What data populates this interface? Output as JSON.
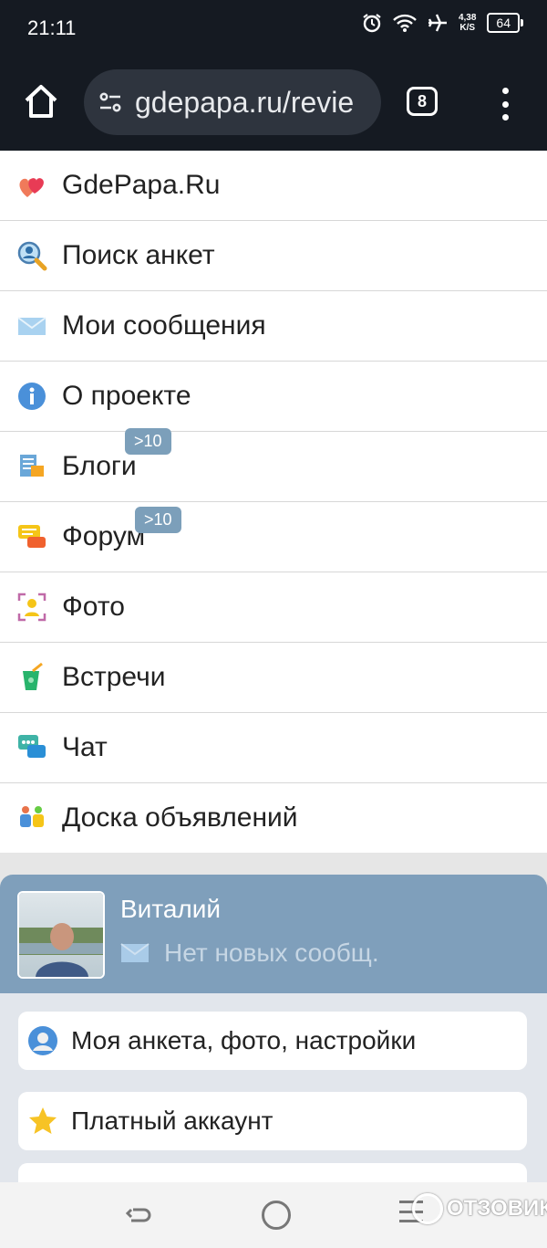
{
  "status_bar": {
    "time": "21:11",
    "speed_value": "4,38",
    "speed_unit": "K/S",
    "battery": "64"
  },
  "browser": {
    "url": "gdepapa.ru/revie",
    "tab_count": "8"
  },
  "menu": {
    "items": [
      {
        "label": "GdePapa.Ru",
        "icon": "hearts-icon"
      },
      {
        "label": "Поиск анкет",
        "icon": "search-person-icon"
      },
      {
        "label": "Мои сообщения",
        "icon": "envelope-icon"
      },
      {
        "label": "О проекте",
        "icon": "info-icon"
      },
      {
        "label": "Блоги",
        "icon": "blog-icon",
        "badge": ">10"
      },
      {
        "label": "Форум",
        "icon": "forum-icon",
        "badge": ">10"
      },
      {
        "label": "Фото",
        "icon": "photo-icon"
      },
      {
        "label": "Встречи",
        "icon": "drink-icon"
      },
      {
        "label": "Чат",
        "icon": "chat-icon"
      },
      {
        "label": "Доска объявлений",
        "icon": "board-icon"
      }
    ]
  },
  "profile": {
    "name": "Виталий",
    "messages": "Нет новых сообщ."
  },
  "cards": [
    {
      "label": "Моя анкета, фото, настройки",
      "icon": "user-icon"
    },
    {
      "label": "Платный аккаунт",
      "icon": "star-icon"
    }
  ],
  "watermark": {
    "text": "ОТЗОВИК"
  }
}
